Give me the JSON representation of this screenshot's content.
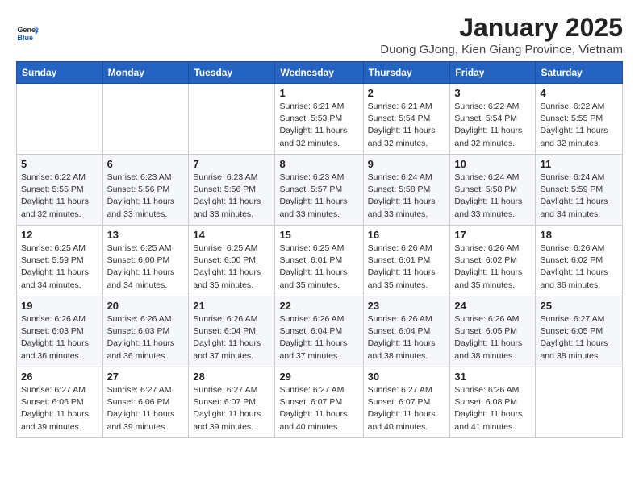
{
  "logo": {
    "general": "General",
    "blue": "Blue"
  },
  "title": "January 2025",
  "subtitle": "Duong GJong, Kien Giang Province, Vietnam",
  "days_of_week": [
    "Sunday",
    "Monday",
    "Tuesday",
    "Wednesday",
    "Thursday",
    "Friday",
    "Saturday"
  ],
  "weeks": [
    [
      {
        "day": "",
        "info": ""
      },
      {
        "day": "",
        "info": ""
      },
      {
        "day": "",
        "info": ""
      },
      {
        "day": "1",
        "info": "Sunrise: 6:21 AM\nSunset: 5:53 PM\nDaylight: 11 hours and 32 minutes."
      },
      {
        "day": "2",
        "info": "Sunrise: 6:21 AM\nSunset: 5:54 PM\nDaylight: 11 hours and 32 minutes."
      },
      {
        "day": "3",
        "info": "Sunrise: 6:22 AM\nSunset: 5:54 PM\nDaylight: 11 hours and 32 minutes."
      },
      {
        "day": "4",
        "info": "Sunrise: 6:22 AM\nSunset: 5:55 PM\nDaylight: 11 hours and 32 minutes."
      }
    ],
    [
      {
        "day": "5",
        "info": "Sunrise: 6:22 AM\nSunset: 5:55 PM\nDaylight: 11 hours and 32 minutes."
      },
      {
        "day": "6",
        "info": "Sunrise: 6:23 AM\nSunset: 5:56 PM\nDaylight: 11 hours and 33 minutes."
      },
      {
        "day": "7",
        "info": "Sunrise: 6:23 AM\nSunset: 5:56 PM\nDaylight: 11 hours and 33 minutes."
      },
      {
        "day": "8",
        "info": "Sunrise: 6:23 AM\nSunset: 5:57 PM\nDaylight: 11 hours and 33 minutes."
      },
      {
        "day": "9",
        "info": "Sunrise: 6:24 AM\nSunset: 5:58 PM\nDaylight: 11 hours and 33 minutes."
      },
      {
        "day": "10",
        "info": "Sunrise: 6:24 AM\nSunset: 5:58 PM\nDaylight: 11 hours and 33 minutes."
      },
      {
        "day": "11",
        "info": "Sunrise: 6:24 AM\nSunset: 5:59 PM\nDaylight: 11 hours and 34 minutes."
      }
    ],
    [
      {
        "day": "12",
        "info": "Sunrise: 6:25 AM\nSunset: 5:59 PM\nDaylight: 11 hours and 34 minutes."
      },
      {
        "day": "13",
        "info": "Sunrise: 6:25 AM\nSunset: 6:00 PM\nDaylight: 11 hours and 34 minutes."
      },
      {
        "day": "14",
        "info": "Sunrise: 6:25 AM\nSunset: 6:00 PM\nDaylight: 11 hours and 35 minutes."
      },
      {
        "day": "15",
        "info": "Sunrise: 6:25 AM\nSunset: 6:01 PM\nDaylight: 11 hours and 35 minutes."
      },
      {
        "day": "16",
        "info": "Sunrise: 6:26 AM\nSunset: 6:01 PM\nDaylight: 11 hours and 35 minutes."
      },
      {
        "day": "17",
        "info": "Sunrise: 6:26 AM\nSunset: 6:02 PM\nDaylight: 11 hours and 35 minutes."
      },
      {
        "day": "18",
        "info": "Sunrise: 6:26 AM\nSunset: 6:02 PM\nDaylight: 11 hours and 36 minutes."
      }
    ],
    [
      {
        "day": "19",
        "info": "Sunrise: 6:26 AM\nSunset: 6:03 PM\nDaylight: 11 hours and 36 minutes."
      },
      {
        "day": "20",
        "info": "Sunrise: 6:26 AM\nSunset: 6:03 PM\nDaylight: 11 hours and 36 minutes."
      },
      {
        "day": "21",
        "info": "Sunrise: 6:26 AM\nSunset: 6:04 PM\nDaylight: 11 hours and 37 minutes."
      },
      {
        "day": "22",
        "info": "Sunrise: 6:26 AM\nSunset: 6:04 PM\nDaylight: 11 hours and 37 minutes."
      },
      {
        "day": "23",
        "info": "Sunrise: 6:26 AM\nSunset: 6:04 PM\nDaylight: 11 hours and 38 minutes."
      },
      {
        "day": "24",
        "info": "Sunrise: 6:26 AM\nSunset: 6:05 PM\nDaylight: 11 hours and 38 minutes."
      },
      {
        "day": "25",
        "info": "Sunrise: 6:27 AM\nSunset: 6:05 PM\nDaylight: 11 hours and 38 minutes."
      }
    ],
    [
      {
        "day": "26",
        "info": "Sunrise: 6:27 AM\nSunset: 6:06 PM\nDaylight: 11 hours and 39 minutes."
      },
      {
        "day": "27",
        "info": "Sunrise: 6:27 AM\nSunset: 6:06 PM\nDaylight: 11 hours and 39 minutes."
      },
      {
        "day": "28",
        "info": "Sunrise: 6:27 AM\nSunset: 6:07 PM\nDaylight: 11 hours and 39 minutes."
      },
      {
        "day": "29",
        "info": "Sunrise: 6:27 AM\nSunset: 6:07 PM\nDaylight: 11 hours and 40 minutes."
      },
      {
        "day": "30",
        "info": "Sunrise: 6:27 AM\nSunset: 6:07 PM\nDaylight: 11 hours and 40 minutes."
      },
      {
        "day": "31",
        "info": "Sunrise: 6:26 AM\nSunset: 6:08 PM\nDaylight: 11 hours and 41 minutes."
      },
      {
        "day": "",
        "info": ""
      }
    ]
  ]
}
